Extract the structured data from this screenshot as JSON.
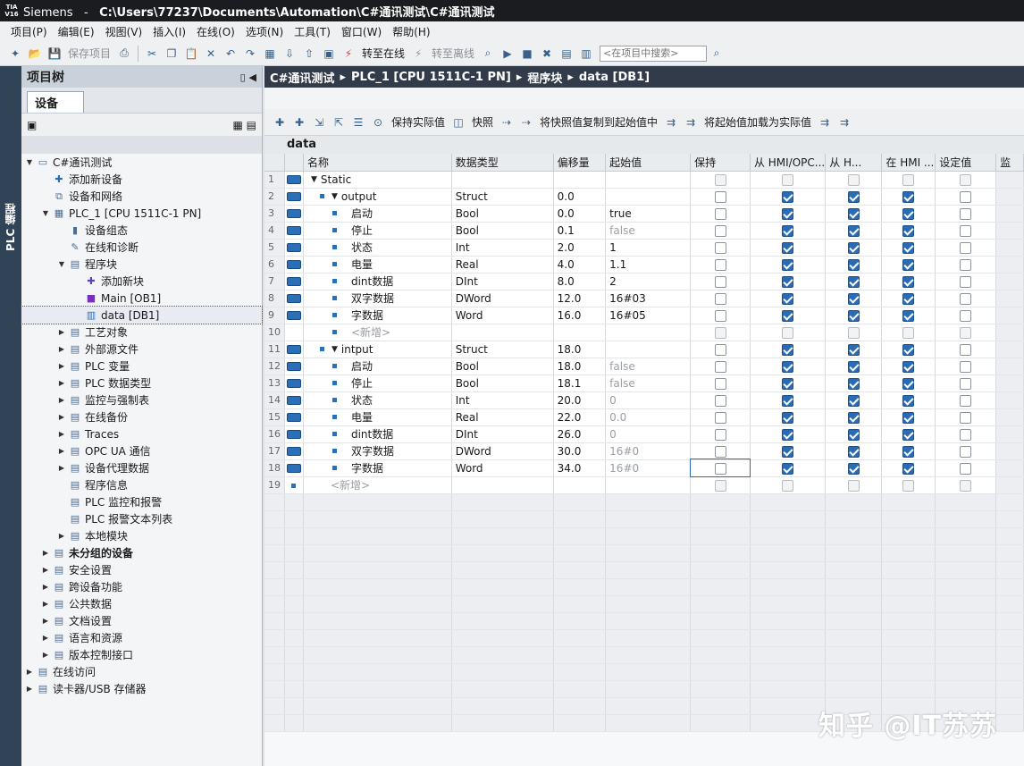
{
  "title": {
    "app": "Siemens",
    "sep": "-",
    "path": "C:\\Users\\77237\\Documents\\Automation\\C#通讯测试\\C#通讯测试",
    "logo": "TIA V16"
  },
  "menu": [
    "项目(P)",
    "编辑(E)",
    "视图(V)",
    "插入(I)",
    "在线(O)",
    "选项(N)",
    "工具(T)",
    "窗口(W)",
    "帮助(H)"
  ],
  "toolbar": {
    "save_project": "保存项目",
    "go_online": "转至在线",
    "go_offline": "转至离线",
    "search_placeholder": "<在项目中搜索>"
  },
  "left_strip_label": "PLC 编程",
  "project_tree": {
    "header": "项目树",
    "tab": "设备",
    "items": [
      {
        "label": "C#通讯测试",
        "level": 0,
        "arrow": "▼",
        "icon": "project-icon",
        "bold": false
      },
      {
        "label": "添加新设备",
        "level": 1,
        "arrow": "",
        "icon": "add-device-icon",
        "bold": false
      },
      {
        "label": "设备和网络",
        "level": 1,
        "arrow": "",
        "icon": "network-icon",
        "bold": false
      },
      {
        "label": "PLC_1 [CPU 1511C-1 PN]",
        "level": 1,
        "arrow": "▼",
        "icon": "plc-icon",
        "bold": false
      },
      {
        "label": "设备组态",
        "level": 2,
        "arrow": "",
        "icon": "device-config-icon",
        "bold": false
      },
      {
        "label": "在线和诊断",
        "level": 2,
        "arrow": "",
        "icon": "diagnostics-icon",
        "bold": false
      },
      {
        "label": "程序块",
        "level": 2,
        "arrow": "▼",
        "icon": "folder-icon",
        "bold": false
      },
      {
        "label": "添加新块",
        "level": 3,
        "arrow": "",
        "icon": "add-block-icon",
        "bold": false
      },
      {
        "label": "Main [OB1]",
        "level": 3,
        "arrow": "",
        "icon": "ob-icon",
        "bold": false
      },
      {
        "label": "data [DB1]",
        "level": 3,
        "arrow": "",
        "icon": "db-icon",
        "bold": false,
        "selected": true
      },
      {
        "label": "工艺对象",
        "level": 2,
        "arrow": "▶",
        "icon": "folder-icon",
        "bold": false
      },
      {
        "label": "外部源文件",
        "level": 2,
        "arrow": "▶",
        "icon": "folder-icon",
        "bold": false
      },
      {
        "label": "PLC 变量",
        "level": 2,
        "arrow": "▶",
        "icon": "folder-icon",
        "bold": false
      },
      {
        "label": "PLC 数据类型",
        "level": 2,
        "arrow": "▶",
        "icon": "folder-icon",
        "bold": false
      },
      {
        "label": "监控与强制表",
        "level": 2,
        "arrow": "▶",
        "icon": "folder-icon",
        "bold": false
      },
      {
        "label": "在线备份",
        "level": 2,
        "arrow": "▶",
        "icon": "folder-icon",
        "bold": false
      },
      {
        "label": "Traces",
        "level": 2,
        "arrow": "▶",
        "icon": "folder-icon",
        "bold": false
      },
      {
        "label": "OPC UA 通信",
        "level": 2,
        "arrow": "▶",
        "icon": "folder-icon",
        "bold": false
      },
      {
        "label": "设备代理数据",
        "level": 2,
        "arrow": "▶",
        "icon": "folder-icon",
        "bold": false
      },
      {
        "label": "程序信息",
        "level": 2,
        "arrow": "",
        "icon": "info-icon",
        "bold": false
      },
      {
        "label": "PLC 监控和报警",
        "level": 2,
        "arrow": "",
        "icon": "alarm-icon",
        "bold": false
      },
      {
        "label": "PLC 报警文本列表",
        "level": 2,
        "arrow": "",
        "icon": "alarm-text-icon",
        "bold": false
      },
      {
        "label": "本地模块",
        "level": 2,
        "arrow": "▶",
        "icon": "folder-icon",
        "bold": false
      },
      {
        "label": "未分组的设备",
        "level": 1,
        "arrow": "▶",
        "icon": "folder-icon",
        "bold": true
      },
      {
        "label": "安全设置",
        "level": 1,
        "arrow": "▶",
        "icon": "folder-icon",
        "bold": false
      },
      {
        "label": "跨设备功能",
        "level": 1,
        "arrow": "▶",
        "icon": "folder-icon",
        "bold": false
      },
      {
        "label": "公共数据",
        "level": 1,
        "arrow": "▶",
        "icon": "folder-icon",
        "bold": false
      },
      {
        "label": "文档设置",
        "level": 1,
        "arrow": "▶",
        "icon": "folder-icon",
        "bold": false
      },
      {
        "label": "语言和资源",
        "level": 1,
        "arrow": "▶",
        "icon": "folder-icon",
        "bold": false
      },
      {
        "label": "版本控制接口",
        "level": 1,
        "arrow": "▶",
        "icon": "folder-icon",
        "bold": false
      },
      {
        "label": "在线访问",
        "level": 0,
        "arrow": "▶",
        "icon": "folder-icon",
        "bold": false
      },
      {
        "label": "读卡器/USB 存储器",
        "level": 0,
        "arrow": "▶",
        "icon": "folder-icon",
        "bold": false
      }
    ]
  },
  "breadcrumb": [
    "C#通讯测试",
    "PLC_1 [CPU 1511C-1 PN]",
    "程序块",
    "data [DB1]"
  ],
  "editor_toolbar": {
    "keep_actual": "保持实际值",
    "snapshot": "快照",
    "copy_snapshot": "将快照值复制到起始值中",
    "load_start": "将起始值加载为实际值"
  },
  "block_name": "data",
  "grid": {
    "columns": [
      "名称",
      "数据类型",
      "偏移量",
      "起始值",
      "保持",
      "从 HMI/OPC...",
      "从 H...",
      "在 HMI ...",
      "设定值",
      "监"
    ],
    "rows": [
      {
        "n": "1",
        "indent": 0,
        "expand": "▼",
        "name": "Static",
        "type": "",
        "offset": "",
        "start": "",
        "start_grey": false,
        "kind": "section",
        "c": [
          0,
          0,
          0,
          0
        ]
      },
      {
        "n": "2",
        "indent": 1,
        "expand": "▼",
        "name": "output",
        "type": "Struct",
        "offset": "0.0",
        "start": "",
        "start_grey": false,
        "kind": "struct",
        "c": [
          0,
          1,
          1,
          1
        ]
      },
      {
        "n": "3",
        "indent": 2,
        "expand": "",
        "name": "启动",
        "type": "Bool",
        "offset": "0.0",
        "start": "true",
        "start_grey": false,
        "kind": "var",
        "c": [
          0,
          1,
          1,
          1
        ]
      },
      {
        "n": "4",
        "indent": 2,
        "expand": "",
        "name": "停止",
        "type": "Bool",
        "offset": "0.1",
        "start": "false",
        "start_grey": true,
        "kind": "var",
        "c": [
          0,
          1,
          1,
          1
        ]
      },
      {
        "n": "5",
        "indent": 2,
        "expand": "",
        "name": "状态",
        "type": "Int",
        "offset": "2.0",
        "start": "1",
        "start_grey": false,
        "kind": "var",
        "c": [
          0,
          1,
          1,
          1
        ]
      },
      {
        "n": "6",
        "indent": 2,
        "expand": "",
        "name": "电量",
        "type": "Real",
        "offset": "4.0",
        "start": "1.1",
        "start_grey": false,
        "kind": "var",
        "c": [
          0,
          1,
          1,
          1
        ]
      },
      {
        "n": "7",
        "indent": 2,
        "expand": "",
        "name": "dint数据",
        "type": "DInt",
        "offset": "8.0",
        "start": "2",
        "start_grey": false,
        "kind": "var",
        "c": [
          0,
          1,
          1,
          1
        ]
      },
      {
        "n": "8",
        "indent": 2,
        "expand": "",
        "name": "双字数据",
        "type": "DWord",
        "offset": "12.0",
        "start": "16#03",
        "start_grey": false,
        "kind": "var",
        "c": [
          0,
          1,
          1,
          1
        ]
      },
      {
        "n": "9",
        "indent": 2,
        "expand": "",
        "name": "字数据",
        "type": "Word",
        "offset": "16.0",
        "start": "16#05",
        "start_grey": false,
        "kind": "var",
        "c": [
          0,
          1,
          1,
          1
        ]
      },
      {
        "n": "10",
        "indent": 2,
        "expand": "",
        "name": "<新增>",
        "type": "",
        "offset": "",
        "start": "",
        "start_grey": false,
        "kind": "add",
        "c": [
          0,
          0,
          0,
          0
        ]
      },
      {
        "n": "11",
        "indent": 1,
        "expand": "▼",
        "name": "intput",
        "type": "Struct",
        "offset": "18.0",
        "start": "",
        "start_grey": false,
        "kind": "struct",
        "c": [
          0,
          1,
          1,
          1
        ]
      },
      {
        "n": "12",
        "indent": 2,
        "expand": "",
        "name": "启动",
        "type": "Bool",
        "offset": "18.0",
        "start": "false",
        "start_grey": true,
        "kind": "var",
        "c": [
          0,
          1,
          1,
          1
        ]
      },
      {
        "n": "13",
        "indent": 2,
        "expand": "",
        "name": "停止",
        "type": "Bool",
        "offset": "18.1",
        "start": "false",
        "start_grey": true,
        "kind": "var",
        "c": [
          0,
          1,
          1,
          1
        ]
      },
      {
        "n": "14",
        "indent": 2,
        "expand": "",
        "name": "状态",
        "type": "Int",
        "offset": "20.0",
        "start": "0",
        "start_grey": true,
        "kind": "var",
        "c": [
          0,
          1,
          1,
          1
        ]
      },
      {
        "n": "15",
        "indent": 2,
        "expand": "",
        "name": "电量",
        "type": "Real",
        "offset": "22.0",
        "start": "0.0",
        "start_grey": true,
        "kind": "var",
        "c": [
          0,
          1,
          1,
          1
        ]
      },
      {
        "n": "16",
        "indent": 2,
        "expand": "",
        "name": "dint数据",
        "type": "DInt",
        "offset": "26.0",
        "start": "0",
        "start_grey": true,
        "kind": "var",
        "c": [
          0,
          1,
          1,
          1
        ]
      },
      {
        "n": "17",
        "indent": 2,
        "expand": "",
        "name": "双字数据",
        "type": "DWord",
        "offset": "30.0",
        "start": "16#0",
        "start_grey": true,
        "kind": "var",
        "c": [
          0,
          1,
          1,
          1
        ]
      },
      {
        "n": "18",
        "indent": 2,
        "expand": "",
        "name": "字数据",
        "type": "Word",
        "offset": "34.0",
        "start": "16#0",
        "start_grey": true,
        "kind": "var",
        "c": [
          0,
          1,
          1,
          1
        ],
        "selected": true
      },
      {
        "n": "19",
        "indent": 1,
        "expand": "",
        "name": "<新增>",
        "type": "",
        "offset": "",
        "start": "",
        "start_grey": false,
        "kind": "add",
        "c": [
          0,
          0,
          0,
          0
        ]
      }
    ]
  },
  "watermark": "知乎 @IT苏苏",
  "colors": {
    "titlebar": "#1b1c1f",
    "breadcrumb": "#313b49",
    "check": "#2a6bb6",
    "strip": "#314357"
  }
}
